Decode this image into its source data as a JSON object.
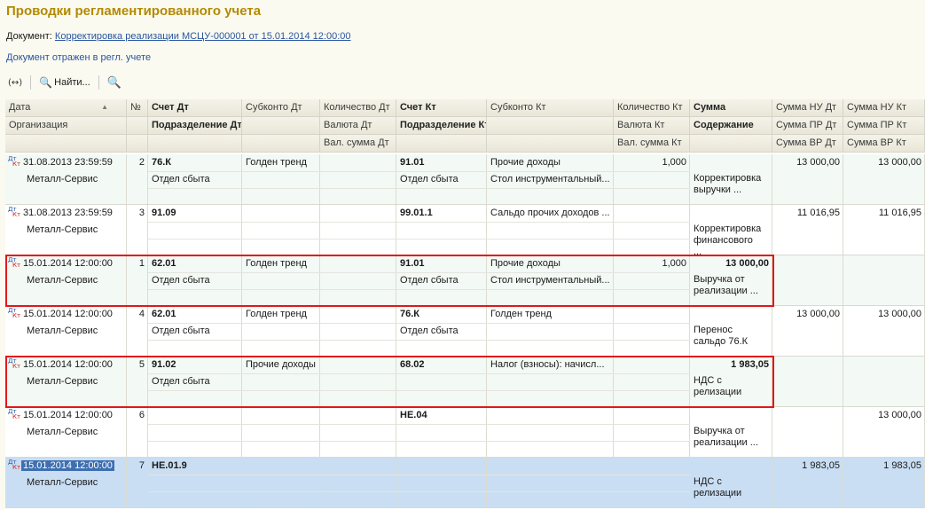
{
  "title": "Проводки регламентированного учета",
  "document": {
    "label": "Документ:",
    "link": "Корректировка реализации МСЦУ-000001 от 15.01.2014 12:00:00"
  },
  "status": "Документ отражен в регл. учете",
  "toolbar": {
    "arrows": "(↔)",
    "find": "Найти...",
    "icons": [
      "arrows-icon",
      "search-icon",
      "cancel-search-icon"
    ]
  },
  "headers": {
    "row1": [
      "Дата",
      "№",
      "Счет Дт",
      "Субконто Дт",
      "Количество Дт",
      "Счет Кт",
      "Субконто Кт",
      "Количество Кт",
      "Сумма",
      "Сумма НУ Дт",
      "Сумма НУ Кт"
    ],
    "row2": [
      "Организация",
      "",
      "Подразделение Дт",
      "",
      "Валюта Дт",
      "Подразделение Кт",
      "",
      "Валюта Кт",
      "Содержание",
      "Сумма ПР Дт",
      "Сумма ПР Кт"
    ],
    "row3": [
      "",
      "",
      "",
      "",
      "Вал. сумма Дт",
      "",
      "",
      "Вал. сумма Кт",
      "",
      "Сумма ВР Дт",
      "Сумма ВР Кт"
    ]
  },
  "rows": [
    {
      "date": "31.08.2013 23:59:59",
      "num": "2",
      "org": "Металл-Сервис",
      "acc_dt": "76.К",
      "sub_dt": "Голден тренд",
      "dep_dt": "Отдел сбыта",
      "qty_dt": "",
      "acc_kt": "91.01",
      "sub_kt": "Прочие доходы",
      "sub_kt2": "Стол инструментальный...",
      "dep_kt": "Отдел сбыта",
      "qty_kt": "1,000",
      "sum": "",
      "content": "Корректировка выручки ...",
      "nu_dt": "13 000,00",
      "nu_kt": "13 000,00"
    },
    {
      "date": "31.08.2013 23:59:59",
      "num": "3",
      "org": "Металл-Сервис",
      "acc_dt": "91.09",
      "sub_dt": "",
      "dep_dt": "",
      "qty_dt": "",
      "acc_kt": "99.01.1",
      "sub_kt": "Сальдо прочих доходов ...",
      "sub_kt2": "",
      "dep_kt": "",
      "qty_kt": "",
      "sum": "",
      "content": "Корректировка финансового ...",
      "nu_dt": "11 016,95",
      "nu_kt": "11 016,95"
    },
    {
      "date": "15.01.2014 12:00:00",
      "num": "1",
      "org": "Металл-Сервис",
      "acc_dt": "62.01",
      "sub_dt": "Голден тренд",
      "dep_dt": "Отдел сбыта",
      "qty_dt": "",
      "acc_kt": "91.01",
      "sub_kt": "Прочие доходы",
      "sub_kt2": "Стол инструментальный...",
      "dep_kt": "Отдел сбыта",
      "qty_kt": "1,000",
      "sum": "13 000,00",
      "content": "Выручка от реализации ...",
      "nu_dt": "",
      "nu_kt": ""
    },
    {
      "date": "15.01.2014 12:00:00",
      "num": "4",
      "org": "Металл-Сервис",
      "acc_dt": "62.01",
      "sub_dt": "Голден тренд",
      "dep_dt": "Отдел сбыта",
      "qty_dt": "",
      "acc_kt": "76.К",
      "sub_kt": "Голден тренд",
      "sub_kt2": "",
      "dep_kt": "Отдел сбыта",
      "qty_kt": "",
      "sum": "",
      "content": "Перенос сальдо 76.К",
      "nu_dt": "13 000,00",
      "nu_kt": "13 000,00"
    },
    {
      "date": "15.01.2014 12:00:00",
      "num": "5",
      "org": "Металл-Сервис",
      "acc_dt": "91.02",
      "sub_dt": "Прочие доходы",
      "dep_dt": "Отдел сбыта",
      "qty_dt": "",
      "acc_kt": "68.02",
      "sub_kt": "Налог (взносы): начисл...",
      "sub_kt2": "",
      "dep_kt": "",
      "qty_kt": "",
      "sum": "1 983,05",
      "content": "НДС с релизации",
      "nu_dt": "",
      "nu_kt": ""
    },
    {
      "date": "15.01.2014 12:00:00",
      "num": "6",
      "org": "Металл-Сервис",
      "acc_dt": "",
      "sub_dt": "",
      "dep_dt": "",
      "qty_dt": "",
      "acc_kt": "НЕ.04",
      "sub_kt": "",
      "sub_kt2": "",
      "dep_kt": "",
      "qty_kt": "",
      "sum": "",
      "content": "Выручка от реализации ...",
      "nu_dt": "",
      "nu_kt": "13 000,00"
    },
    {
      "date": "15.01.2014 12:00:00",
      "num": "7",
      "org": "Металл-Сервис",
      "acc_dt": "НЕ.01.9",
      "sub_dt": "",
      "dep_dt": "",
      "qty_dt": "",
      "acc_kt": "",
      "sub_kt": "",
      "sub_kt2": "",
      "dep_kt": "",
      "qty_kt": "",
      "sum": "",
      "content": "НДС с релизации",
      "nu_dt": "1 983,05",
      "nu_kt": "1 983,05"
    }
  ],
  "highlighted_rows": [
    2,
    4
  ],
  "selected_row": 6,
  "colors": {
    "title": "#b48a00",
    "link": "#2955a0",
    "highlight_border": "#e21818",
    "selected_row": "#c9def3",
    "alt_row": "#f3f9f4"
  }
}
